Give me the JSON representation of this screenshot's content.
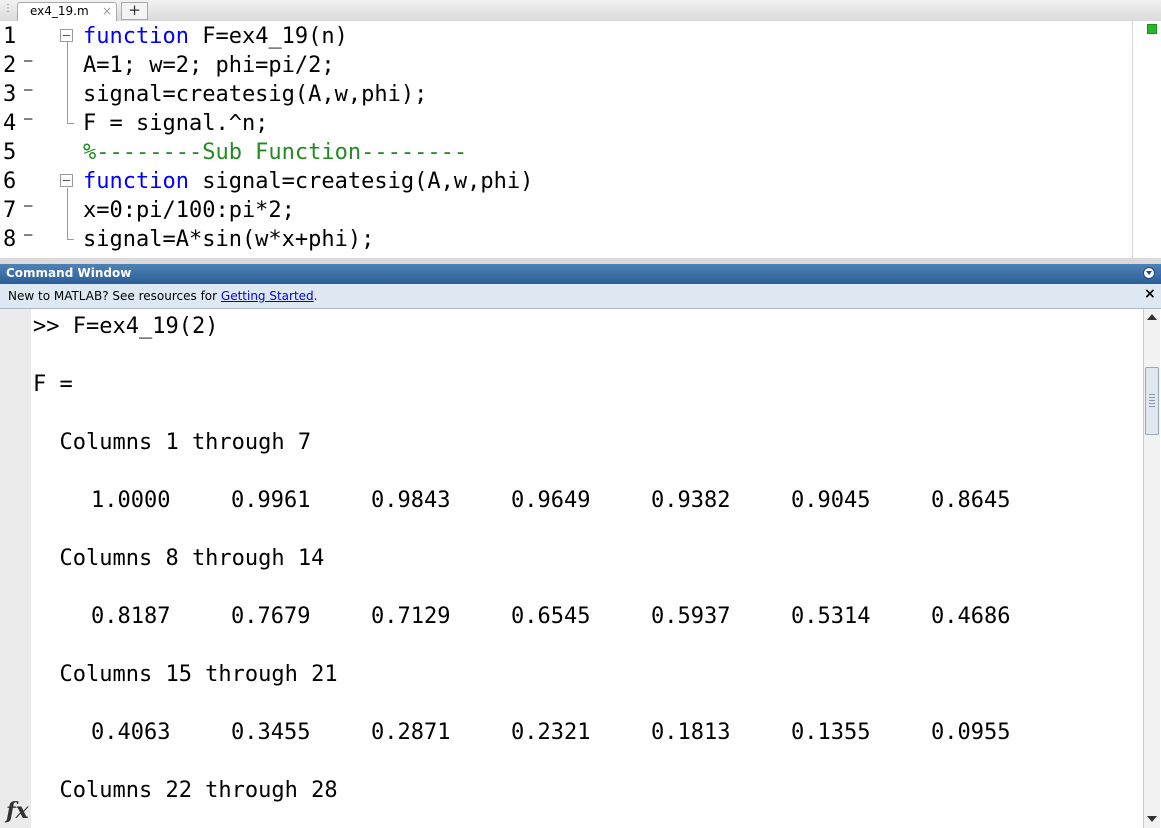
{
  "tabs": [
    {
      "label": "ex4_19.m",
      "close_glyph": "×"
    }
  ],
  "add_tab_glyph": "+",
  "editor": {
    "lines": [
      {
        "num": "1",
        "dash": "",
        "keyword": "function",
        "text": " F=ex4_19(n)"
      },
      {
        "num": "2",
        "dash": "–",
        "text": "A=1; w=2; phi=pi/2;"
      },
      {
        "num": "3",
        "dash": "–",
        "text": "signal=createsig(A,w,phi);"
      },
      {
        "num": "4",
        "dash": "–",
        "text": "F = signal.^n;"
      },
      {
        "num": "5",
        "dash": "",
        "comment": "%--------Sub Function--------"
      },
      {
        "num": "6",
        "dash": "",
        "keyword": "function",
        "text": " signal=createsig(A,w,phi)"
      },
      {
        "num": "7",
        "dash": "–",
        "text": "x=0:pi/100:pi*2;"
      },
      {
        "num": "8",
        "dash": "–",
        "text": "signal=A*sin(w*x+phi);"
      }
    ]
  },
  "command_window": {
    "title": "Command Window",
    "info_text": "New to MATLAB? See resources for ",
    "info_link": "Getting Started",
    "info_suffix": ".",
    "info_close": "×",
    "prompt_line": ">> F=ex4_19(2)",
    "var_line": "F =",
    "blocks": [
      {
        "header": "  Columns 1 through 7",
        "values": [
          "1.0000",
          "0.9961",
          "0.9843",
          "0.9649",
          "0.9382",
          "0.9045",
          "0.8645"
        ]
      },
      {
        "header": "  Columns 8 through 14",
        "values": [
          "0.8187",
          "0.7679",
          "0.7129",
          "0.6545",
          "0.5937",
          "0.5314",
          "0.4686"
        ]
      },
      {
        "header": "  Columns 15 through 21",
        "values": [
          "0.4063",
          "0.3455",
          "0.2871",
          "0.2321",
          "0.1813",
          "0.1355",
          "0.0955"
        ]
      },
      {
        "header": "  Columns 22 through 28",
        "values": []
      }
    ],
    "fx_label": "fx"
  }
}
